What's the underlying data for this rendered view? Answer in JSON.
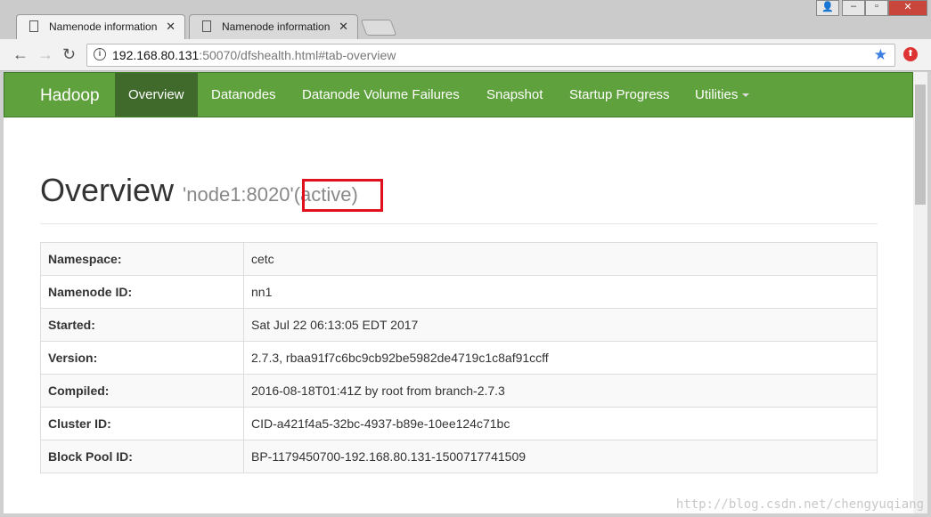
{
  "browser": {
    "tabs": [
      {
        "title": "Namenode information",
        "active": true
      },
      {
        "title": "Namenode information",
        "active": false
      }
    ],
    "url_host": "192.168.80.131",
    "url_rest": ":50070/dfshealth.html#tab-overview"
  },
  "navbar": {
    "brand": "Hadoop",
    "items": [
      "Overview",
      "Datanodes",
      "Datanode Volume Failures",
      "Snapshot",
      "Startup Progress",
      "Utilities"
    ],
    "active": "Overview",
    "color": "#5fa13c"
  },
  "overview": {
    "title": "Overview",
    "node": "'node1:8020'",
    "state": "(active)",
    "highlight_color": "#e0101e"
  },
  "info": [
    {
      "k": "Namespace:",
      "v": "cetc"
    },
    {
      "k": "Namenode ID:",
      "v": "nn1"
    },
    {
      "k": "Started:",
      "v": "Sat Jul 22 06:13:05 EDT 2017"
    },
    {
      "k": "Version:",
      "v": "2.7.3, rbaa91f7c6bc9cb92be5982de4719c1c8af91ccff"
    },
    {
      "k": "Compiled:",
      "v": "2016-08-18T01:41Z by root from branch-2.7.3"
    },
    {
      "k": "Cluster ID:",
      "v": "CID-a421f4a5-32bc-4937-b89e-10ee124c71bc"
    },
    {
      "k": "Block Pool ID:",
      "v": "BP-1179450700-192.168.80.131-1500717741509"
    }
  ],
  "watermark": "http://blog.csdn.net/chengyuqiang"
}
